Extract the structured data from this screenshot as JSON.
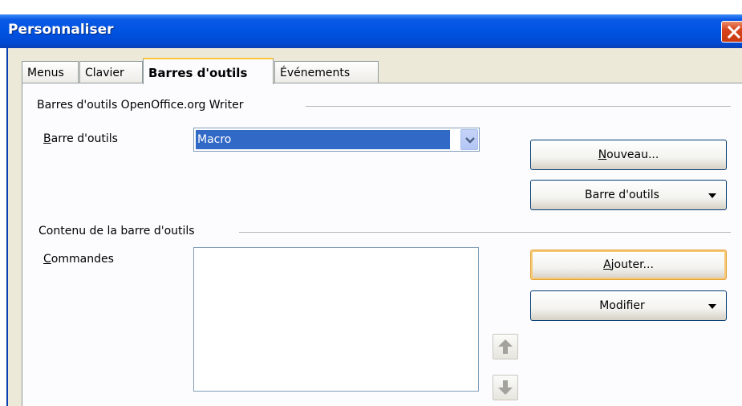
{
  "window": {
    "title": "Personnaliser",
    "close_icon": "close-icon",
    "colors": {
      "titlebar": "#0053e1",
      "close": "#d8431c",
      "selection": "#3169c6"
    }
  },
  "tabs": [
    {
      "label": "Menus",
      "active": false
    },
    {
      "label": "Clavier",
      "active": false
    },
    {
      "label": "Barres d'outils",
      "active": true
    },
    {
      "label": "Événements",
      "active": false
    }
  ],
  "toolbars_group": {
    "title": "Barres d'outils OpenOffice.org Writer",
    "toolbar_label_mnemonic": "B",
    "toolbar_label_rest": "arre d'outils",
    "toolbar_value": "Macro",
    "new_button_mnemonic": "N",
    "new_button_rest": "ouveau...",
    "toolbar_menu_button": "Barre d'outils"
  },
  "content_group": {
    "title": "Contenu de la barre d'outils",
    "commands_label_mnemonic": "C",
    "commands_label_rest": "ommandes",
    "commands": [],
    "add_button_mnemonic": "A",
    "add_button_rest": "jouter...",
    "modify_button": "Modifier",
    "move_up_icon": "arrow-up-icon",
    "move_down_icon": "arrow-down-icon"
  }
}
